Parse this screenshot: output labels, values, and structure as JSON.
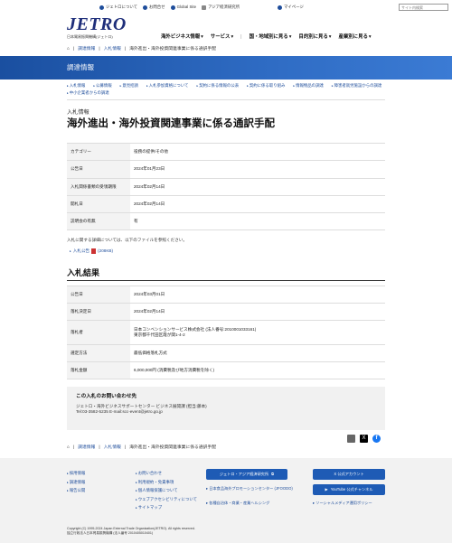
{
  "utility": {
    "items": [
      "ジェトロについて",
      "お問合せ",
      "Global Site",
      "アジア経済研究所"
    ],
    "mypage": "マイページ",
    "search_placeholder": "サイト内検索"
  },
  "logo": {
    "mark": "JETRO",
    "sub": "日本貿易振興機構(ジェトロ)"
  },
  "nav": [
    "海外ビジネス情報",
    "サービス",
    "国・地域別に見る",
    "目的別に見る",
    "産業別に見る"
  ],
  "breadcrumb": [
    "調達情報",
    "入札情報",
    "海外進出・海外投資関連事業に係る通訳手配"
  ],
  "banner_title": "調達情報",
  "sublinks": [
    "入札情報",
    "公募情報",
    "意見招請",
    "入札参加資格について",
    "契約に係る情報の公表",
    "契約に係る取り組み",
    "情報物品の調達",
    "障害者就労施設からの調達",
    "中小企業者からの調達"
  ],
  "kind": "入札情報",
  "title": "海外進出・海外投資関連事業に係る通訳手配",
  "details": [
    {
      "k": "カテゴリー",
      "v": "役務の提供/その他"
    },
    {
      "k": "公告日",
      "v": "2024年01月23日"
    },
    {
      "k": "入札関係書類の受領期限",
      "v": "2024年02月14日"
    },
    {
      "k": "開札日",
      "v": "2024年02月14日"
    },
    {
      "k": "説明会の有無",
      "v": "有"
    }
  ],
  "note": "入札に関する詳細については、以下のファイルを参照ください。",
  "pdf_link": "入札公告",
  "pdf_size": "(208KB)",
  "result_heading": "入札結果",
  "results": [
    {
      "k": "公告日",
      "v": "2024年03月01日"
    },
    {
      "k": "落札決定日",
      "v": "2024年02月14日"
    },
    {
      "k": "落札者",
      "v": "日本コンベンションサービス株式会社 (法人番号:2010001033161)",
      "v2": "東京都千代田区霞が関1-4-2"
    },
    {
      "k": "選定方法",
      "v": "最低価格落札方式"
    },
    {
      "k": "落札金額",
      "v": "6,000,000円 (消費税及び地方消費税を除く)"
    }
  ],
  "contact": {
    "heading": "この入札のお問い合わせ先",
    "line1": "ジェトロ・海外ビジネスサポートセンター ビジネス展開課 (担当:藤本)",
    "line2": "Tel:03-3582-5235 E-mail:scc-event@jetro.go.jp"
  },
  "share": {
    "x": "X",
    "fb": "f"
  },
  "footer": {
    "col1": [
      "採用情報",
      "調達情報",
      "報告公開"
    ],
    "col2": [
      "お問い合わせ",
      "利用規約・免責事項",
      "個人情報保護について",
      "ウェブアクセシビリティについて",
      "サイトマップ"
    ],
    "btn_asia": "ジェトロ・アジア経済研究所",
    "btn_x": "X 公式アカウント",
    "btn_yt": "YouTube 公式チャンネル",
    "links_mid": [
      "日本食品海外プロモーションセンター (JFOODO)",
      "各種自治体・商業・産業ヘルシング"
    ],
    "link_social": "ソーシャルメディア運用ポリシー",
    "copyright": "Copyright (C) 1995-2024 Japan External Trade Organization(JETRO). All rights reserved.",
    "org": "独立行政法人日本貿易振興機構 (法人番号 2010405010401)"
  }
}
